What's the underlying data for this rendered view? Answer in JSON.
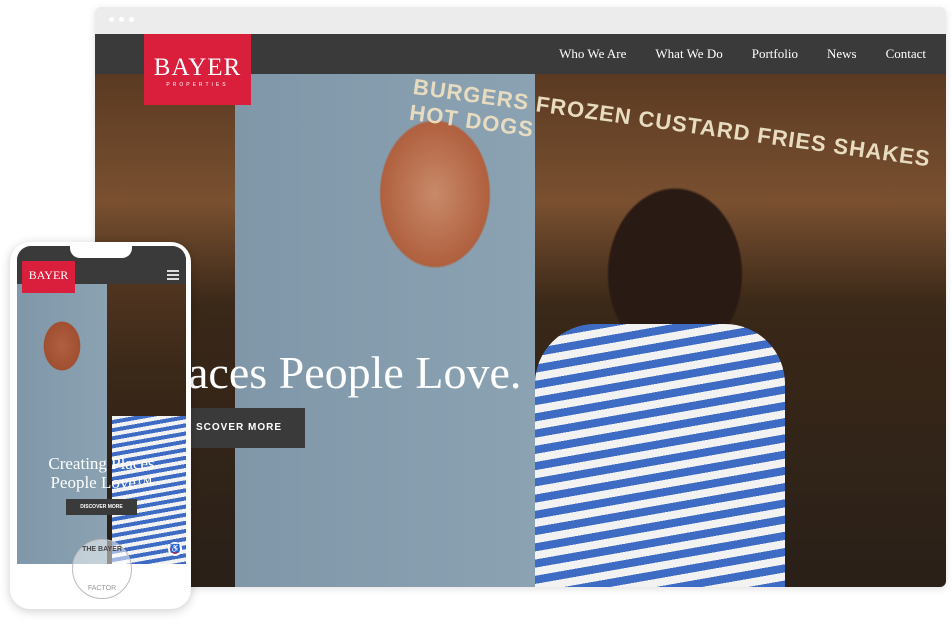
{
  "desktop": {
    "logo": {
      "name": "BAYER",
      "sub": "PROPERTIES"
    },
    "nav": [
      "Who We Are",
      "What We Do",
      "Portfolio",
      "News",
      "Contact"
    ],
    "hero": {
      "title": "aces People Love.",
      "button": "SCOVER MORE",
      "sign": "BURGERS FROZEN CUSTARD FRIES SHAKES HOT DOGS"
    }
  },
  "mobile": {
    "logo": "BAYER",
    "hero": {
      "title_line1": "Creating Places",
      "title_line2": "People Love™",
      "button": "DISCOVER MORE"
    },
    "badge": {
      "top": "THE BAYER",
      "bottom": "FACTOR"
    }
  },
  "colors": {
    "brand": "#d91f3c",
    "nav": "#3a3a3a"
  }
}
